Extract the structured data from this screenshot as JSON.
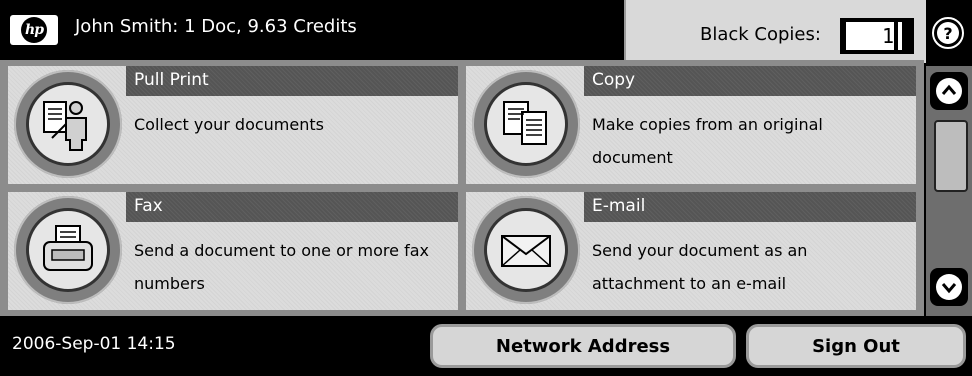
{
  "header": {
    "user_status": "John Smith: 1 Doc, 9.63 Credits",
    "copies_label": "Black Copies:",
    "copies_value": "1",
    "help_label": "?",
    "logo_text": "hp"
  },
  "tiles": [
    {
      "title": "Pull Print",
      "description": "Collect your documents",
      "icon": "pull-print-icon"
    },
    {
      "title": "Copy",
      "description": "Make copies from an original document",
      "icon": "copy-icon"
    },
    {
      "title": "Fax",
      "description": "Send a document to one or more fax numbers",
      "icon": "fax-icon"
    },
    {
      "title": "E-mail",
      "description": "Send your document as an attachment to an e-mail",
      "icon": "email-icon"
    }
  ],
  "footer": {
    "datetime": "2006-Sep-01 14:15",
    "network_address_label": "Network Address",
    "sign_out_label": "Sign Out"
  },
  "colors": {
    "tile_bg": "#dcdcdc",
    "tile_title_bg": "#555555",
    "bar_bg": "#000000"
  }
}
